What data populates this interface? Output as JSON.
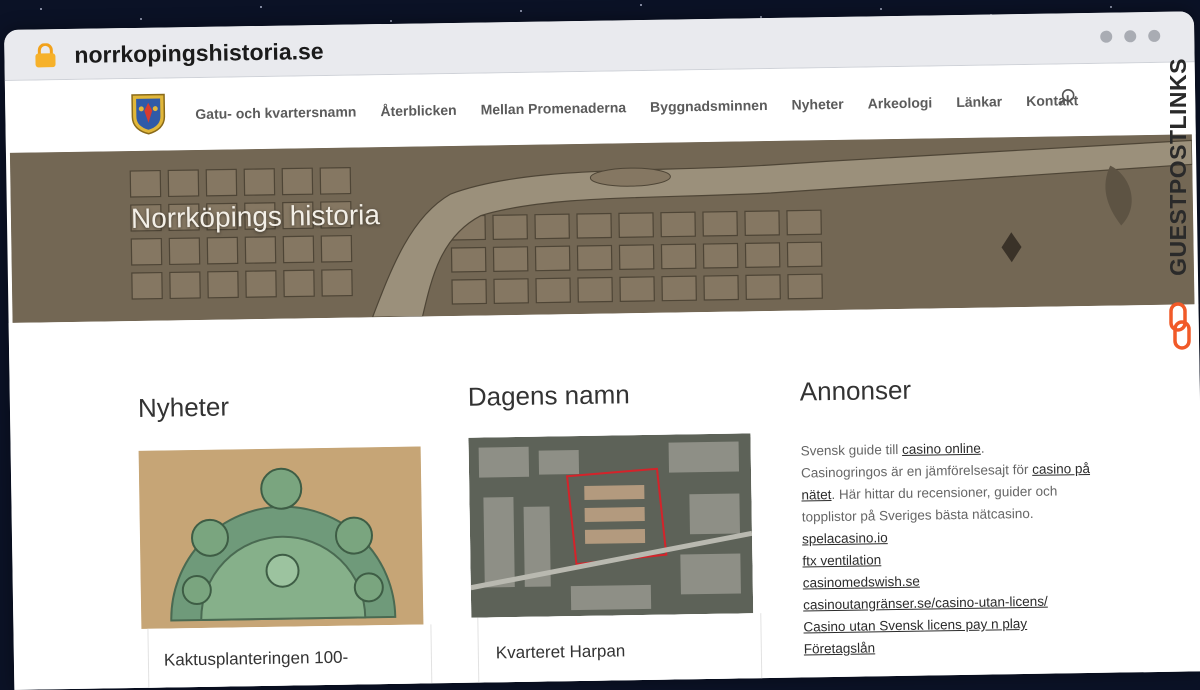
{
  "browser": {
    "url": "norrkopingshistoria.se"
  },
  "nav": {
    "items": [
      "Gatu- och kvartersnamn",
      "Återblicken",
      "Mellan Promenaderna",
      "Byggnadsminnen",
      "Nyheter",
      "Arkeologi",
      "Länkar",
      "Kontakt"
    ]
  },
  "hero": {
    "title": "Norrköpings historia"
  },
  "columns": {
    "news": {
      "title": "Nyheter",
      "caption": "Kaktusplanteringen 100-"
    },
    "name": {
      "title": "Dagens namn",
      "caption": "Kvarteret Harpan"
    },
    "ads": {
      "title": "Annonser",
      "p1_prefix": "Svensk guide till ",
      "p1_link": "casino online",
      "p1_suffix": ".",
      "p2_prefix": "Casinogringos är en jämförelsesajt för ",
      "p2_link": "casino på nätet",
      "p2_suffix": ". Här hittar du recensioner, guider och topplistor på Sveriges bästa nätcasino.",
      "links": [
        "spelacasino.io",
        "ftx ventilation",
        "casinomedswish.se",
        "casinoutangränser.se/casino-utan-licens/",
        "Casino utan Svensk licens pay n play",
        "Företagslån"
      ]
    }
  },
  "watermark": {
    "text": "GUESTPOSTLINKS"
  },
  "colors": {
    "accent_orange": "#f15a29",
    "map_sepia": "#6f6452",
    "background_space": "#0b1226"
  }
}
